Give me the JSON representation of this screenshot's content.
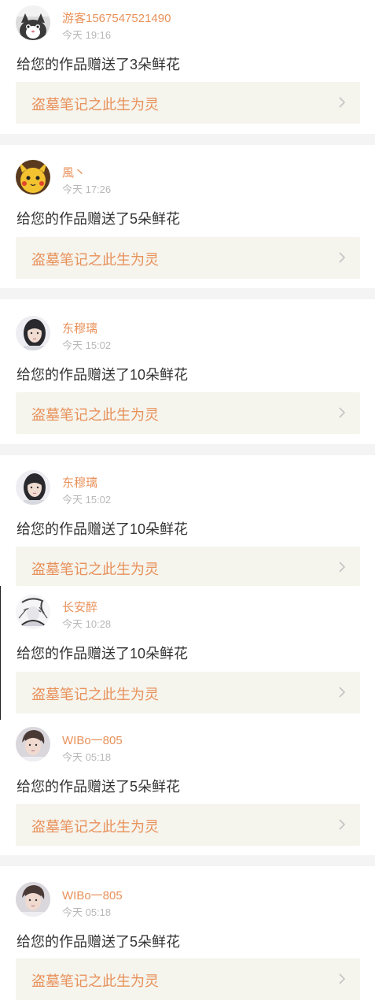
{
  "feed": [
    {
      "username": "游客1567547521490",
      "time": "今天 19:16",
      "message": "给您的作品赠送了3朵鲜花",
      "work_title": "盗墓笔记之此生为灵",
      "avatar": "cat-avatar"
    },
    {
      "username": "風丶",
      "time": "今天 17:26",
      "message": "给您的作品赠送了5朵鲜花",
      "work_title": "盗墓笔记之此生为灵",
      "avatar": "pikachu-avatar"
    },
    {
      "username": "东穆璃",
      "time": "今天 15:02",
      "message": "给您的作品赠送了10朵鲜花",
      "work_title": "盗墓笔记之此生为灵",
      "avatar": "girl-avatar"
    },
    {
      "username": "东穆璃",
      "time": "今天 15:02",
      "message": "给您的作品赠送了10朵鲜花",
      "work_title": "盗墓笔记之此生为灵",
      "avatar": "girl-avatar"
    },
    {
      "username": "长安醉",
      "time": "今天 10:28",
      "message": "给您的作品赠送了10朵鲜花",
      "work_title": "盗墓笔记之此生为灵",
      "avatar": "sketch-avatar"
    },
    {
      "username": "WIBo一805",
      "time": "今天 05:18",
      "message": "给您的作品赠送了5朵鲜花",
      "work_title": "盗墓笔记之此生为灵",
      "avatar": "boy-avatar"
    },
    {
      "username": "WIBo一805",
      "time": "今天 05:18",
      "message": "给您的作品赠送了5朵鲜花",
      "work_title": "盗墓笔记之此生为灵",
      "avatar": "boy-avatar"
    }
  ],
  "colors": {
    "accent": "#e8915a",
    "time": "#b8b8b8",
    "text": "#333333",
    "work_bg": "#f5f4ed",
    "page_bg": "#f4f4f4"
  }
}
